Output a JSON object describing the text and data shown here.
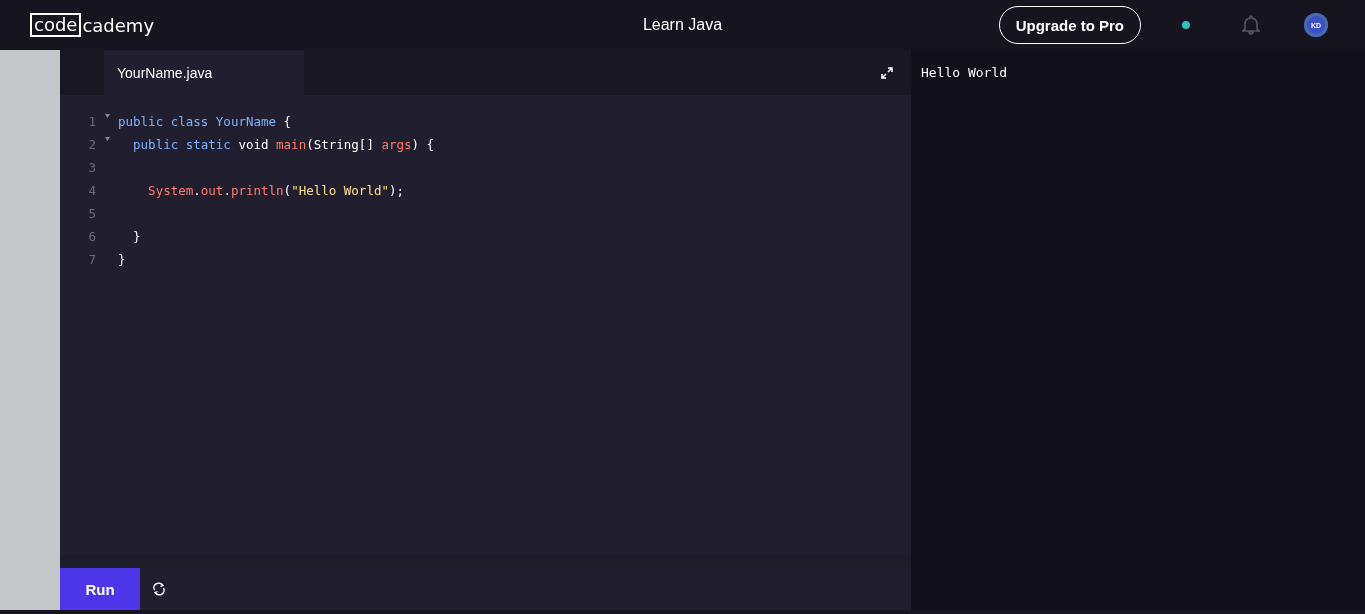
{
  "header": {
    "logo": {
      "boxed": "code",
      "rest": "cademy"
    },
    "title": "Learn Java",
    "upgrade_button": "Upgrade to Pro",
    "avatar": "KD"
  },
  "editor": {
    "tabs": [
      {
        "label": "YourName.java",
        "selected": true
      }
    ],
    "lines": [
      {
        "number": "1",
        "fold": true,
        "tokens": [
          {
            "text": "public class ",
            "kind": "keyword"
          },
          {
            "text": "YourName",
            "kind": "type"
          },
          {
            "text": " {",
            "kind": "plain"
          }
        ]
      },
      {
        "number": "2",
        "fold": true,
        "tokens": [
          {
            "text": "  public static ",
            "kind": "keyword"
          },
          {
            "text": "void ",
            "kind": "plain"
          },
          {
            "text": "main",
            "kind": "name"
          },
          {
            "text": "(String[] ",
            "kind": "plain"
          },
          {
            "text": "args",
            "kind": "name"
          },
          {
            "text": ") {",
            "kind": "plain"
          }
        ]
      },
      {
        "number": "3",
        "fold": false
      },
      {
        "number": "4",
        "fold": false,
        "tokens": [
          {
            "text": "    System",
            "kind": "name"
          },
          {
            "text": ".",
            "kind": "plain"
          },
          {
            "text": "out",
            "kind": "name"
          },
          {
            "text": ".",
            "kind": "plain"
          },
          {
            "text": "println",
            "kind": "name"
          },
          {
            "text": "(",
            "kind": "plain"
          },
          {
            "text": "\"Hello World\"",
            "kind": "string"
          },
          {
            "text": ");",
            "kind": "plain"
          }
        ]
      },
      {
        "number": "5",
        "fold": false
      },
      {
        "number": "6",
        "fold": false,
        "tokens": [
          {
            "text": "  }",
            "kind": "plain"
          }
        ]
      },
      {
        "number": "7",
        "fold": false,
        "tokens": [
          {
            "text": "}",
            "kind": "plain"
          }
        ]
      }
    ],
    "run_button": "Run"
  },
  "output": {
    "lines": [
      "Hello World"
    ]
  }
}
